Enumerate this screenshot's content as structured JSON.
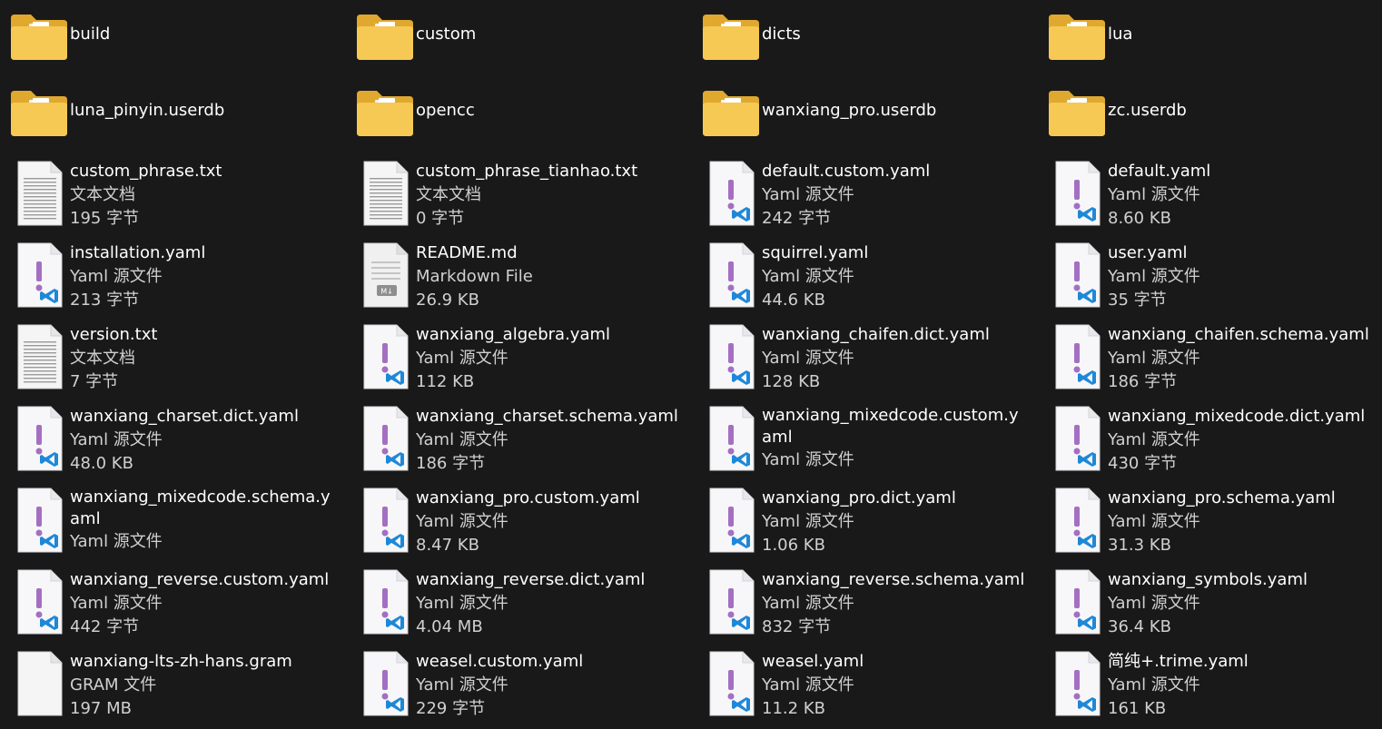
{
  "explorer": {
    "items": [
      {
        "type": "folder",
        "name": "build"
      },
      {
        "type": "folder",
        "name": "custom"
      },
      {
        "type": "folder",
        "name": "dicts"
      },
      {
        "type": "folder",
        "name": "lua"
      },
      {
        "type": "folder",
        "name": "luna_pinyin.userdb"
      },
      {
        "type": "folder",
        "name": "opencc"
      },
      {
        "type": "folder",
        "name": "wanxiang_pro.userdb"
      },
      {
        "type": "folder",
        "name": "zc.userdb"
      },
      {
        "type": "file",
        "icon": "text",
        "name": "custom_phrase.txt",
        "kind": "文本文档",
        "size": "195 字节"
      },
      {
        "type": "file",
        "icon": "text",
        "name": "custom_phrase_tianhao.txt",
        "kind": "文本文档",
        "size": "0 字节"
      },
      {
        "type": "file",
        "icon": "yaml",
        "name": "default.custom.yaml",
        "kind": "Yaml 源文件",
        "size": "242 字节"
      },
      {
        "type": "file",
        "icon": "yaml",
        "name": "default.yaml",
        "kind": "Yaml 源文件",
        "size": "8.60 KB"
      },
      {
        "type": "file",
        "icon": "yaml",
        "name": "installation.yaml",
        "kind": "Yaml 源文件",
        "size": "213 字节"
      },
      {
        "type": "file",
        "icon": "markdown",
        "name": "README.md",
        "kind": "Markdown File",
        "size": "26.9 KB"
      },
      {
        "type": "file",
        "icon": "yaml",
        "name": "squirrel.yaml",
        "kind": "Yaml 源文件",
        "size": "44.6 KB"
      },
      {
        "type": "file",
        "icon": "yaml",
        "name": "user.yaml",
        "kind": "Yaml 源文件",
        "size": "35 字节"
      },
      {
        "type": "file",
        "icon": "text",
        "name": "version.txt",
        "kind": "文本文档",
        "size": "7 字节"
      },
      {
        "type": "file",
        "icon": "yaml",
        "name": "wanxiang_algebra.yaml",
        "kind": "Yaml 源文件",
        "size": "112 KB"
      },
      {
        "type": "file",
        "icon": "yaml",
        "name": "wanxiang_chaifen.dict.yaml",
        "kind": "Yaml 源文件",
        "size": "128 KB"
      },
      {
        "type": "file",
        "icon": "yaml",
        "name": "wanxiang_chaifen.schema.yaml",
        "kind": "Yaml 源文件",
        "size": "186 字节"
      },
      {
        "type": "file",
        "icon": "yaml",
        "name": "wanxiang_charset.dict.yaml",
        "kind": "Yaml 源文件",
        "size": "48.0 KB"
      },
      {
        "type": "file",
        "icon": "yaml",
        "name": "wanxiang_charset.schema.yaml",
        "kind": "Yaml 源文件",
        "size": "186 字节"
      },
      {
        "type": "file",
        "icon": "yaml",
        "name": "wanxiang_mixedcode.custom.yaml",
        "kind": "Yaml 源文件",
        "size": "",
        "wrap": true
      },
      {
        "type": "file",
        "icon": "yaml",
        "name": "wanxiang_mixedcode.dict.yaml",
        "kind": "Yaml 源文件",
        "size": "430 字节"
      },
      {
        "type": "file",
        "icon": "yaml",
        "name": "wanxiang_mixedcode.schema.yaml",
        "kind": "Yaml 源文件",
        "size": "",
        "wrap": true
      },
      {
        "type": "file",
        "icon": "yaml",
        "name": "wanxiang_pro.custom.yaml",
        "kind": "Yaml 源文件",
        "size": "8.47 KB"
      },
      {
        "type": "file",
        "icon": "yaml",
        "name": "wanxiang_pro.dict.yaml",
        "kind": "Yaml 源文件",
        "size": "1.06 KB"
      },
      {
        "type": "file",
        "icon": "yaml",
        "name": "wanxiang_pro.schema.yaml",
        "kind": "Yaml 源文件",
        "size": "31.3 KB"
      },
      {
        "type": "file",
        "icon": "yaml",
        "name": "wanxiang_reverse.custom.yaml",
        "kind": "Yaml 源文件",
        "size": "442 字节"
      },
      {
        "type": "file",
        "icon": "yaml",
        "name": "wanxiang_reverse.dict.yaml",
        "kind": "Yaml 源文件",
        "size": "4.04 MB"
      },
      {
        "type": "file",
        "icon": "yaml",
        "name": "wanxiang_reverse.schema.yaml",
        "kind": "Yaml 源文件",
        "size": "832 字节"
      },
      {
        "type": "file",
        "icon": "yaml",
        "name": "wanxiang_symbols.yaml",
        "kind": "Yaml 源文件",
        "size": "36.4 KB"
      },
      {
        "type": "file",
        "icon": "blank",
        "name": "wanxiang-lts-zh-hans.gram",
        "kind": "GRAM 文件",
        "size": "197 MB"
      },
      {
        "type": "file",
        "icon": "yaml",
        "name": "weasel.custom.yaml",
        "kind": "Yaml 源文件",
        "size": "229 字节"
      },
      {
        "type": "file",
        "icon": "yaml",
        "name": "weasel.yaml",
        "kind": "Yaml 源文件",
        "size": "11.2 KB"
      },
      {
        "type": "file",
        "icon": "yaml",
        "name": "简纯+.trime.yaml",
        "kind": "Yaml 源文件",
        "size": "161 KB"
      }
    ]
  },
  "colors": {
    "background": "#191919",
    "text": "#ffffff",
    "folder": "#f3c24b",
    "yaml_mark": "#a46fc2",
    "vscode_blue": "#1e88d8"
  }
}
